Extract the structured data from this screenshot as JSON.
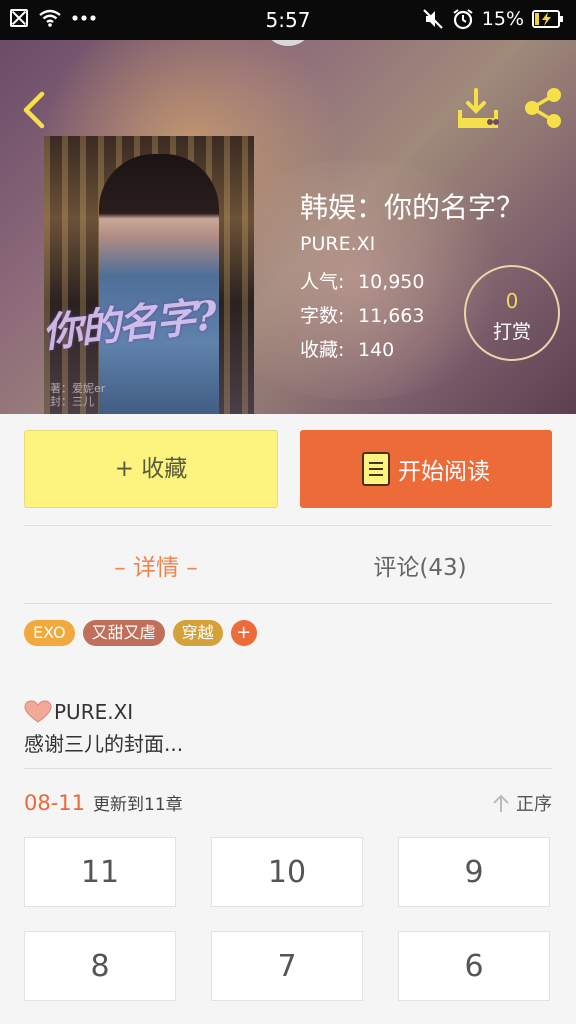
{
  "status_bar": {
    "time": "5:57",
    "battery_percent": "15%"
  },
  "book": {
    "title": "韩娱：你的名字？",
    "author": "PURE.XI",
    "cover_title": "你的名字?",
    "cover_credit_lines": [
      "著：爱妮er",
      "封：三儿"
    ],
    "stats": [
      {
        "label": "人气:",
        "value": "10,950"
      },
      {
        "label": "字数:",
        "value": "11,663"
      },
      {
        "label": "收藏:",
        "value": "140"
      }
    ]
  },
  "reward": {
    "count": "0",
    "label": "打赏"
  },
  "actions": {
    "collect_label": "+ 收藏",
    "read_label": "开始阅读"
  },
  "tabs": {
    "detail": "– 详情 –",
    "comments": "评论(43)"
  },
  "tags": [
    {
      "label": "EXO",
      "color": "#f2a93b"
    },
    {
      "label": "又甜又虐",
      "color": "#c0705a"
    },
    {
      "label": "穿越",
      "color": "#d4a23a"
    },
    {
      "label": "+",
      "color": "#ec6b39"
    }
  ],
  "description": {
    "author": "PURE.XI",
    "text": "感谢三儿的封面..."
  },
  "update": {
    "date": "08-11",
    "text": "更新到11章"
  },
  "order_label": "正序",
  "chapters": [
    "11",
    "10",
    "9",
    "8",
    "7",
    "6"
  ],
  "colors": {
    "accent": "#ec6b39",
    "collect_bg": "#fcf47e",
    "tab_active": "#ef8450"
  }
}
